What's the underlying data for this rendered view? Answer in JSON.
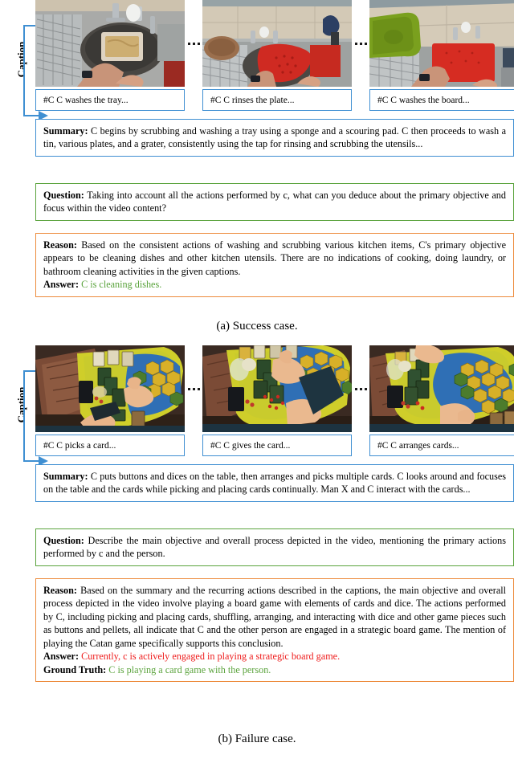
{
  "figure": {
    "subcaption_a": "(a) Success case.",
    "subcaption_b": "(b) Failure case.",
    "caption_bracket_label": "Caption"
  },
  "colors": {
    "caption_box_border": "#3f8fd2",
    "summary_border": "#3f8fd2",
    "question_border": "#5aa33c",
    "reason_border": "#ed8b3c",
    "correct_answer_text": "#5aa33c",
    "wrong_answer_text": "#ee1c1c"
  },
  "labels": {
    "summary": "Summary:",
    "question": "Question:",
    "reason": "Reason:",
    "answer": "Answer:",
    "ground_truth": "Ground Truth:"
  },
  "success_case": {
    "captions": [
      "#C C washes the tray...",
      "#C C rinses the plate...",
      "#C C washes the board..."
    ],
    "frames": [
      {
        "alt": "kitchen-sink-washing-tray"
      },
      {
        "alt": "kitchen-sink-rinsing-red-colander"
      },
      {
        "alt": "kitchen-sink-washing-green-and-red-boards"
      }
    ],
    "summary": "C begins by scrubbing and washing a tray using a sponge and a scouring pad. C then proceeds to wash a tin, various plates, and a grater, consistently using the tap for rinsing and scrubbing the utensils...",
    "question": "Taking into account all the actions performed by c, what can you deduce about the primary objective and focus within the video content?",
    "reason": "Based on the consistent actions of washing and scrubbing various kitchen items, C's primary objective appears to be cleaning dishes and other kitchen utensils. There are no indications of cooking, doing laundry, or bathroom cleaning activities in the given captions.",
    "answer": "C is cleaning dishes."
  },
  "failure_case": {
    "captions": [
      "#C C picks a card...",
      "#C C gives the card...",
      "#C C arranges cards..."
    ],
    "frames": [
      {
        "alt": "board-game-table-picking-card"
      },
      {
        "alt": "board-game-table-giving-card"
      },
      {
        "alt": "board-game-table-arranging-cards"
      }
    ],
    "summary": "C puts buttons and dices on the table, then arranges and picks multiple cards. C looks around and focuses on the table and the cards while picking and placing cards continually. Man X and C interact with the cards...",
    "question": "Describe the main objective and overall process depicted in the video, mentioning the primary actions performed by c and the person.",
    "reason": "Based on the summary and the recurring actions described in the captions, the main objective and overall process depicted in the video involve playing a board game with elements of cards and dice. The actions performed by C, including picking and placing cards, shuffling, arranging, and interacting with dice and other game pieces such as buttons and pellets, all indicate that C and the other person are engaged in a strategic board game. The mention of playing the Catan game specifically supports this conclusion.",
    "answer": "Currently, c is actively engaged in playing a strategic board game.",
    "ground_truth": "C is playing a card game with the person."
  }
}
